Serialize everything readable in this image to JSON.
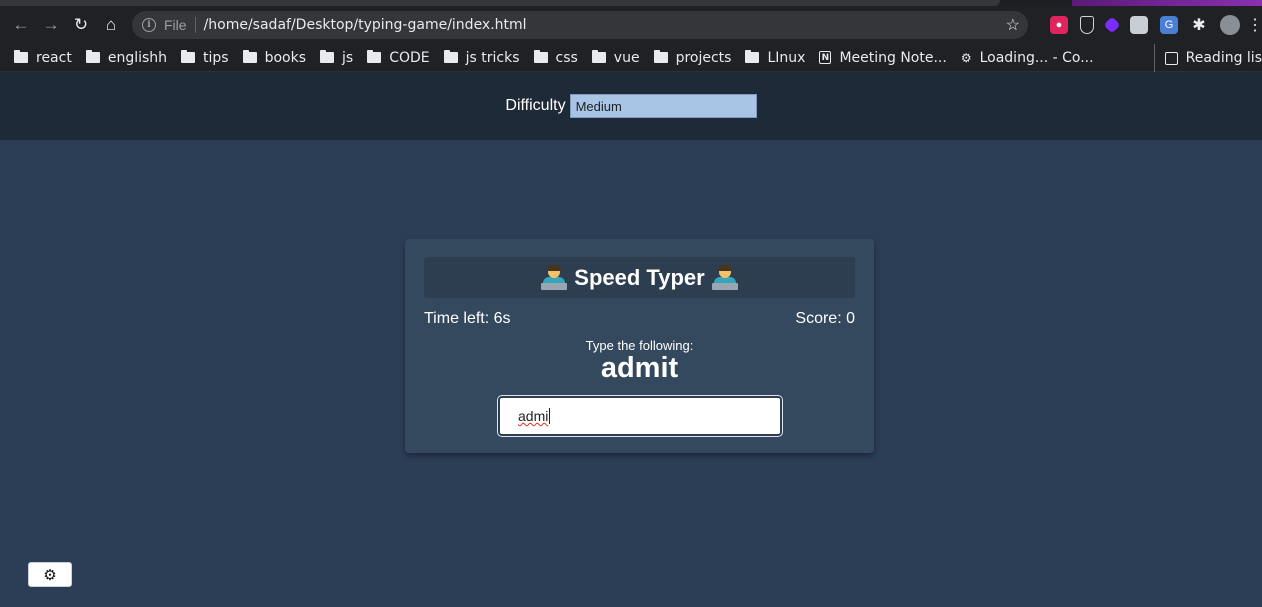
{
  "browser": {
    "url_prefix": "File",
    "url": "/home/sadaf/Desktop/typing-game/index.html",
    "bookmarks": [
      {
        "label": "react",
        "icon": "folder-icon"
      },
      {
        "label": "englishh",
        "icon": "folder-icon"
      },
      {
        "label": "tips",
        "icon": "folder-icon"
      },
      {
        "label": "books",
        "icon": "folder-icon"
      },
      {
        "label": "js",
        "icon": "folder-icon"
      },
      {
        "label": "CODE",
        "icon": "folder-icon"
      },
      {
        "label": "js tricks",
        "icon": "folder-icon"
      },
      {
        "label": "css",
        "icon": "folder-icon"
      },
      {
        "label": "vue",
        "icon": "folder-icon"
      },
      {
        "label": "projects",
        "icon": "folder-icon"
      },
      {
        "label": "LInux",
        "icon": "folder-icon"
      },
      {
        "label": "Meeting Note...",
        "icon": "notion-icon"
      },
      {
        "label": "Loading... - Co...",
        "icon": "gear-icon"
      }
    ],
    "reading_list": "Reading lis"
  },
  "settings": {
    "difficulty_label": "Difficulty",
    "difficulty_value": "Medium"
  },
  "game": {
    "title": "Speed Typer",
    "time_left": "Time left: 6s",
    "score": "Score: 0",
    "prompt": "Type the following:",
    "word": "admit",
    "input_value": "admi"
  },
  "colors": {
    "page_bg": "#2c3e55",
    "header_bg": "#1f2a38",
    "card_bg": "#34495e",
    "title_bg": "#2c3e50",
    "select_bg": "#a8c5e6"
  }
}
